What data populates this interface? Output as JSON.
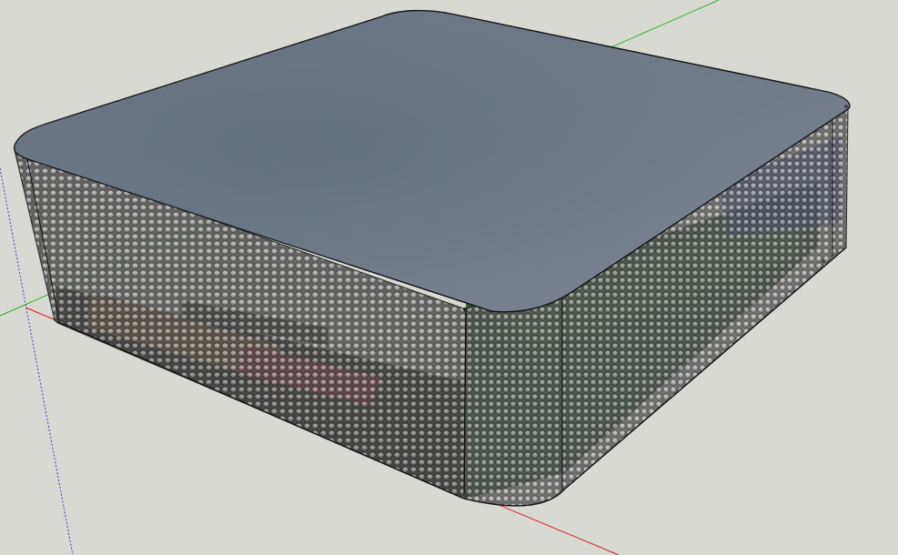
{
  "viewport": {
    "background": "#d9d9d4"
  },
  "axes": {
    "red_color": "#d21e1e",
    "green_color": "#2fb12f",
    "blue_color": "#3a3ad0"
  },
  "model": {
    "top_color": "#6e7885",
    "mesh_color": "#3b3b3b",
    "edge_color": "#111111",
    "internal_board_color": "#3e5a3c",
    "internal_red_component_color": "#b83a55",
    "internal_tan_component_color": "#a58458"
  }
}
